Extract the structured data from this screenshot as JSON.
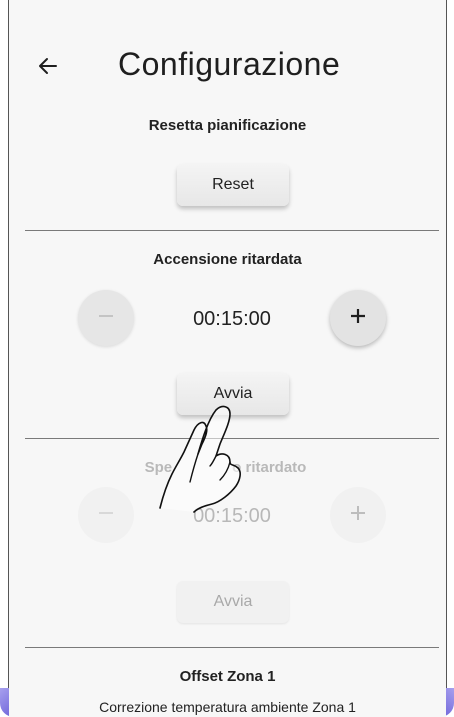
{
  "header": {
    "title": "Configurazione"
  },
  "reset_section": {
    "label": "Resetta pianificazione",
    "button": "Reset"
  },
  "delayed_on": {
    "label": "Accensione ritardata",
    "time": "00:15:00",
    "button": "Avvia"
  },
  "delayed_off": {
    "label_visible": "Spe",
    "label_visible_end": "o ritardato",
    "time_visible": "00:15:00",
    "button": "Avvia"
  },
  "offset_zone": {
    "title": "Offset Zona 1",
    "subtitle": "Correzione temperatura ambiente Zona 1"
  },
  "colors": {
    "accent_gradient_start": "#a7a0ee",
    "accent_gradient_end": "#6c62d9",
    "background": "#f7f7f7"
  }
}
